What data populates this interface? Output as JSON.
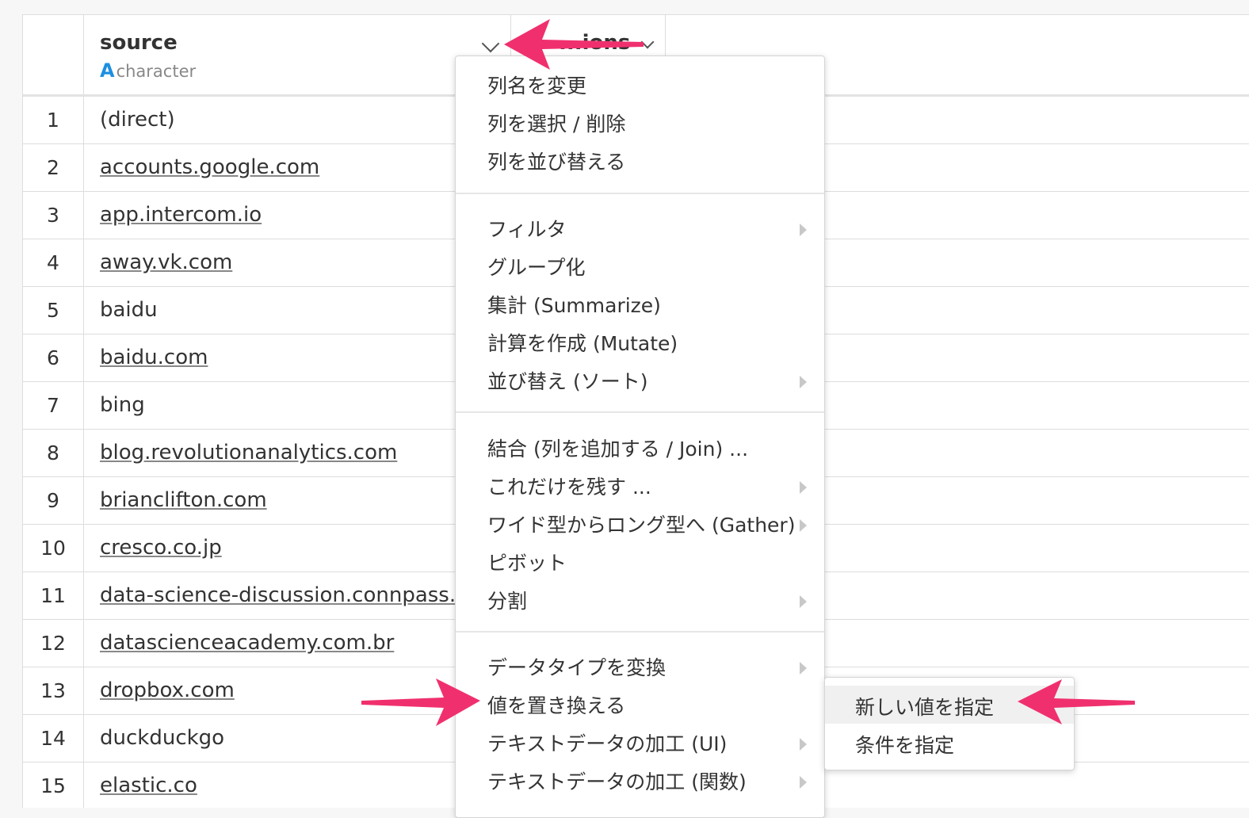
{
  "table": {
    "columns": [
      {
        "name": "source",
        "type": "character",
        "type_icon": "A"
      },
      {
        "name": "...ions"
      }
    ],
    "rows": [
      {
        "n": "1",
        "value": "(direct)",
        "link": false
      },
      {
        "n": "2",
        "value": "accounts.google.com",
        "link": true
      },
      {
        "n": "3",
        "value": "app.intercom.io",
        "link": true
      },
      {
        "n": "4",
        "value": "away.vk.com",
        "link": true
      },
      {
        "n": "5",
        "value": "baidu",
        "link": false
      },
      {
        "n": "6",
        "value": "baidu.com",
        "link": true
      },
      {
        "n": "7",
        "value": "bing",
        "link": false
      },
      {
        "n": "8",
        "value": "blog.revolutionanalytics.com",
        "link": true
      },
      {
        "n": "9",
        "value": "brianclifton.com",
        "link": true
      },
      {
        "n": "10",
        "value": "cresco.co.jp",
        "link": true
      },
      {
        "n": "11",
        "value": "data-science-discussion.connpass.com",
        "link": true
      },
      {
        "n": "12",
        "value": "datascienceacademy.com.br",
        "link": true
      },
      {
        "n": "13",
        "value": "dropbox.com",
        "link": true
      },
      {
        "n": "14",
        "value": "duckduckgo",
        "link": false
      },
      {
        "n": "15",
        "value": "elastic.co",
        "link": true
      }
    ]
  },
  "menu": {
    "groups": [
      [
        {
          "label": "列名を変更",
          "submenu": false
        },
        {
          "label": "列を選択 / 削除",
          "submenu": false
        },
        {
          "label": "列を並び替える",
          "submenu": false
        }
      ],
      [
        {
          "label": "フィルタ",
          "submenu": true
        },
        {
          "label": "グループ化",
          "submenu": false
        },
        {
          "label": "集計 (Summarize)",
          "submenu": false
        },
        {
          "label": "計算を作成 (Mutate)",
          "submenu": false
        },
        {
          "label": "並び替え (ソート)",
          "submenu": true
        }
      ],
      [
        {
          "label": "結合 (列を追加する / Join) ...",
          "submenu": false
        },
        {
          "label": "これだけを残す ...",
          "submenu": true
        },
        {
          "label": "ワイド型からロング型へ (Gather)",
          "submenu": true
        },
        {
          "label": "ピボット",
          "submenu": false
        },
        {
          "label": "分割",
          "submenu": true
        }
      ],
      [
        {
          "label": "データタイプを変換",
          "submenu": true
        },
        {
          "label": "値を置き換える",
          "submenu": false
        },
        {
          "label": "テキストデータの加工 (UI)",
          "submenu": true
        },
        {
          "label": "テキストデータの加工 (関数)",
          "submenu": true
        }
      ]
    ]
  },
  "submenu": {
    "items": [
      {
        "label": "新しい値を指定",
        "highlighted": true
      },
      {
        "label": "条件を指定",
        "highlighted": false
      }
    ]
  },
  "colors": {
    "accent": "#1d8fe1",
    "annotation_arrow": "#f0306e"
  }
}
